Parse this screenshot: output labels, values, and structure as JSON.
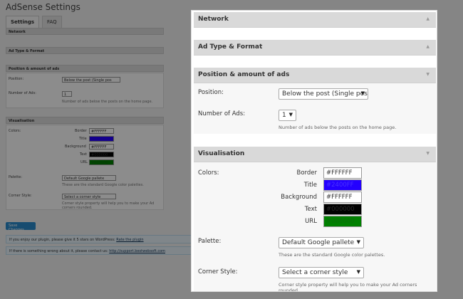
{
  "page": {
    "title": "AdSense Settings",
    "tabs": [
      "Settings",
      "FAQ"
    ]
  },
  "sections": {
    "network": {
      "title": "Network"
    },
    "ad_type": {
      "title": "Ad Type & Format"
    },
    "position_amount": {
      "title": "Position & amount of ads"
    },
    "visualisation": {
      "title": "Visualisation"
    }
  },
  "fields": {
    "position": {
      "label": "Position:",
      "value": "Below the post (Single pos"
    },
    "number_of_ads": {
      "label": "Number of Ads:",
      "value": "1",
      "description": "Number of ads below the posts on the home page."
    },
    "colors": {
      "label": "Colors:",
      "items": [
        {
          "name": "Border",
          "value": "#FFFFFF",
          "hex": "#FFFFFF"
        },
        {
          "name": "Title",
          "value": "#2400FF",
          "hex": "#2400FF"
        },
        {
          "name": "Background",
          "value": "#FFFFFF",
          "hex": "#FFFFFF"
        },
        {
          "name": "Text",
          "value": "#000000",
          "hex": "#000000"
        },
        {
          "name": "URL",
          "value": "#008000",
          "hex": "#008000"
        }
      ]
    },
    "palette": {
      "label": "Palette:",
      "value": "Default Google pallete",
      "description": "These are the standard Google color palettes."
    },
    "corner_style": {
      "label": "Corner Style:",
      "value": "Select a corner style",
      "description": "Corner style property will help you to make your Ad corners rounded."
    }
  },
  "background": {
    "save_button": "Save Changes",
    "note1": "If you enjoy our plugin, please give it 5 stars on WordPress:",
    "note1_link": "Rate the plugin",
    "note2": "If there is something wrong about it, please contact us:",
    "note2_link": "http://support.bestwebsoft.com"
  }
}
